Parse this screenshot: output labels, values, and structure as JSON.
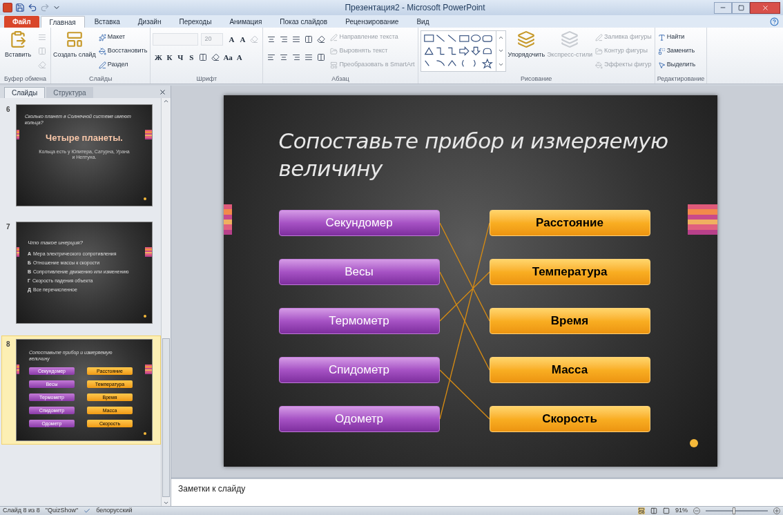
{
  "window": {
    "title": "Презентация2 - Microsoft PowerPoint"
  },
  "menu_tabs": [
    {
      "label": "Файл",
      "kind": "file",
      "selected": false
    },
    {
      "label": "Главная",
      "kind": "tab",
      "selected": true
    },
    {
      "label": "Вставка",
      "kind": "tab",
      "selected": false
    },
    {
      "label": "Дизайн",
      "kind": "tab",
      "selected": false
    },
    {
      "label": "Переходы",
      "kind": "tab",
      "selected": false
    },
    {
      "label": "Анимация",
      "kind": "tab",
      "selected": false
    },
    {
      "label": "Показ слайдов",
      "kind": "tab",
      "selected": false
    },
    {
      "label": "Рецензирование",
      "kind": "tab",
      "selected": false
    },
    {
      "label": "Вид",
      "kind": "tab",
      "selected": false
    }
  ],
  "ribbon": [
    {
      "label": "Буфер обмена",
      "columns": [
        [
          {
            "kind": "large",
            "label": "Вставить",
            "disabled": false
          }
        ],
        [
          {
            "kind": "icon",
            "disabled": true
          },
          {
            "kind": "icon",
            "disabled": true
          },
          {
            "kind": "icon",
            "disabled": true
          }
        ]
      ]
    },
    {
      "label": "Слайды",
      "columns": [
        [
          {
            "kind": "large",
            "label": "Создать слайд",
            "disabled": false
          }
        ],
        [
          {
            "kind": "small",
            "label": "Макет",
            "disabled": false
          },
          {
            "kind": "small",
            "label": "Восстановить",
            "disabled": false
          },
          {
            "kind": "small",
            "label": "Раздел",
            "disabled": false
          }
        ]
      ]
    },
    {
      "label": "Шрифт",
      "columns": [
        [
          {
            "kind": "row",
            "items": [
              {
                "kind": "field",
                "disabled": true
              },
              {
                "kind": "field",
                "label": "20",
                "disabled": true
              },
              {
                "kind": "char",
                "label": "A",
                "disabled": false
              },
              {
                "kind": "char",
                "label": "A",
                "disabled": false
              },
              {
                "kind": "icon",
                "disabled": true
              }
            ]
          },
          {
            "kind": "row",
            "items": [
              {
                "kind": "char",
                "label": "Ж",
                "disabled": false
              },
              {
                "kind": "char",
                "label": "К",
                "disabled": false
              },
              {
                "kind": "char",
                "label": "Ч",
                "disabled": false
              },
              {
                "kind": "char",
                "label": "S",
                "disabled": false
              },
              {
                "kind": "icon",
                "disabled": false
              },
              {
                "kind": "icon",
                "disabled": false
              },
              {
                "kind": "char",
                "label": "Aa",
                "disabled": false
              },
              {
                "kind": "char",
                "label": "A",
                "disabled": false
              }
            ]
          }
        ]
      ]
    },
    {
      "label": "Абзац",
      "columns": [
        [
          {
            "kind": "row",
            "items": [
              {
                "kind": "icon",
                "disabled": false
              },
              {
                "kind": "icon",
                "disabled": false
              },
              {
                "kind": "icon",
                "disabled": false
              },
              {
                "kind": "icon",
                "disabled": false
              },
              {
                "kind": "icon",
                "disabled": false
              }
            ]
          },
          {
            "kind": "row",
            "items": [
              {
                "kind": "icon",
                "disabled": false
              },
              {
                "kind": "icon",
                "disabled": false
              },
              {
                "kind": "icon",
                "disabled": false
              },
              {
                "kind": "icon",
                "disabled": false
              },
              {
                "kind": "icon",
                "disabled": false
              }
            ]
          }
        ],
        [
          {
            "kind": "small",
            "label": "Направление текста",
            "disabled": true
          },
          {
            "kind": "small",
            "label": "Выровнять текст",
            "disabled": true
          },
          {
            "kind": "small",
            "label": "Преобразовать в SmartArt",
            "disabled": true
          }
        ]
      ]
    },
    {
      "label": "Рисование",
      "columns": [
        [
          {
            "kind": "gallery",
            "disabled": false
          }
        ],
        [
          {
            "kind": "large",
            "label": "Упорядочить",
            "disabled": false
          }
        ],
        [
          {
            "kind": "large",
            "label": "Экспресс-стили",
            "disabled": true
          }
        ],
        [
          {
            "kind": "small",
            "label": "Заливка фигуры",
            "disabled": true
          },
          {
            "kind": "small",
            "label": "Контур фигуры",
            "disabled": true
          },
          {
            "kind": "small",
            "label": "Эффекты фигур",
            "disabled": true
          }
        ]
      ]
    },
    {
      "label": "Редактирование",
      "columns": [
        [
          {
            "kind": "small",
            "label": "Найти",
            "disabled": false
          },
          {
            "kind": "small",
            "label": "Заменить",
            "disabled": false
          },
          {
            "kind": "small",
            "label": "Выделить",
            "disabled": false
          }
        ]
      ]
    }
  ],
  "panel_tabs": [
    {
      "label": "Слайды",
      "selected": true
    },
    {
      "label": "Структура",
      "selected": false
    }
  ],
  "slides": [
    {
      "number": "6",
      "kind": "answer",
      "selected": false,
      "question": "Сколько планет в Солнечной системе имеют кольца?",
      "answer": "Четыре планеты.",
      "note": "Кольца есть у Юпитера, Сатурна, Урана и Нептуна."
    },
    {
      "number": "7",
      "kind": "quiz",
      "selected": false,
      "question": "Что такое инерция?",
      "options": [
        {
          "letter": "А",
          "text": "Мера электрического сопротивления"
        },
        {
          "letter": "Б",
          "text": "Отношение массы к скорости"
        },
        {
          "letter": "В",
          "text": "Сопротивление движению или изменению"
        },
        {
          "letter": "Г",
          "text": "Скорость падения объекта"
        },
        {
          "letter": "Д",
          "text": "Все перечисленное"
        }
      ]
    },
    {
      "number": "8",
      "kind": "matching",
      "selected": true,
      "title": "Сопоставьте прибор и измеряемую величину",
      "left": [
        "Секундомер",
        "Весы",
        "Термометр",
        "Спидометр",
        "Одометр"
      ],
      "right": [
        "Расстояние",
        "Температура",
        "Время",
        "Масса",
        "Скорость"
      ]
    }
  ],
  "slide": {
    "title": "Сопоставьте прибор и измеряемую величину",
    "left": [
      "Секундомер",
      "Весы",
      "Термометр",
      "Спидометр",
      "Одометр"
    ],
    "right": [
      "Расстояние",
      "Температура",
      "Время",
      "Масса",
      "Скорость"
    ]
  },
  "notes": {
    "placeholder": "Заметки к слайду"
  },
  "status_bar": {
    "slide": "Слайд 8 из 8",
    "theme": "\"QuizShow\"",
    "language": "белорусский",
    "zoom": "91%",
    "zoom_slider": {
      "level": 0.45
    }
  }
}
